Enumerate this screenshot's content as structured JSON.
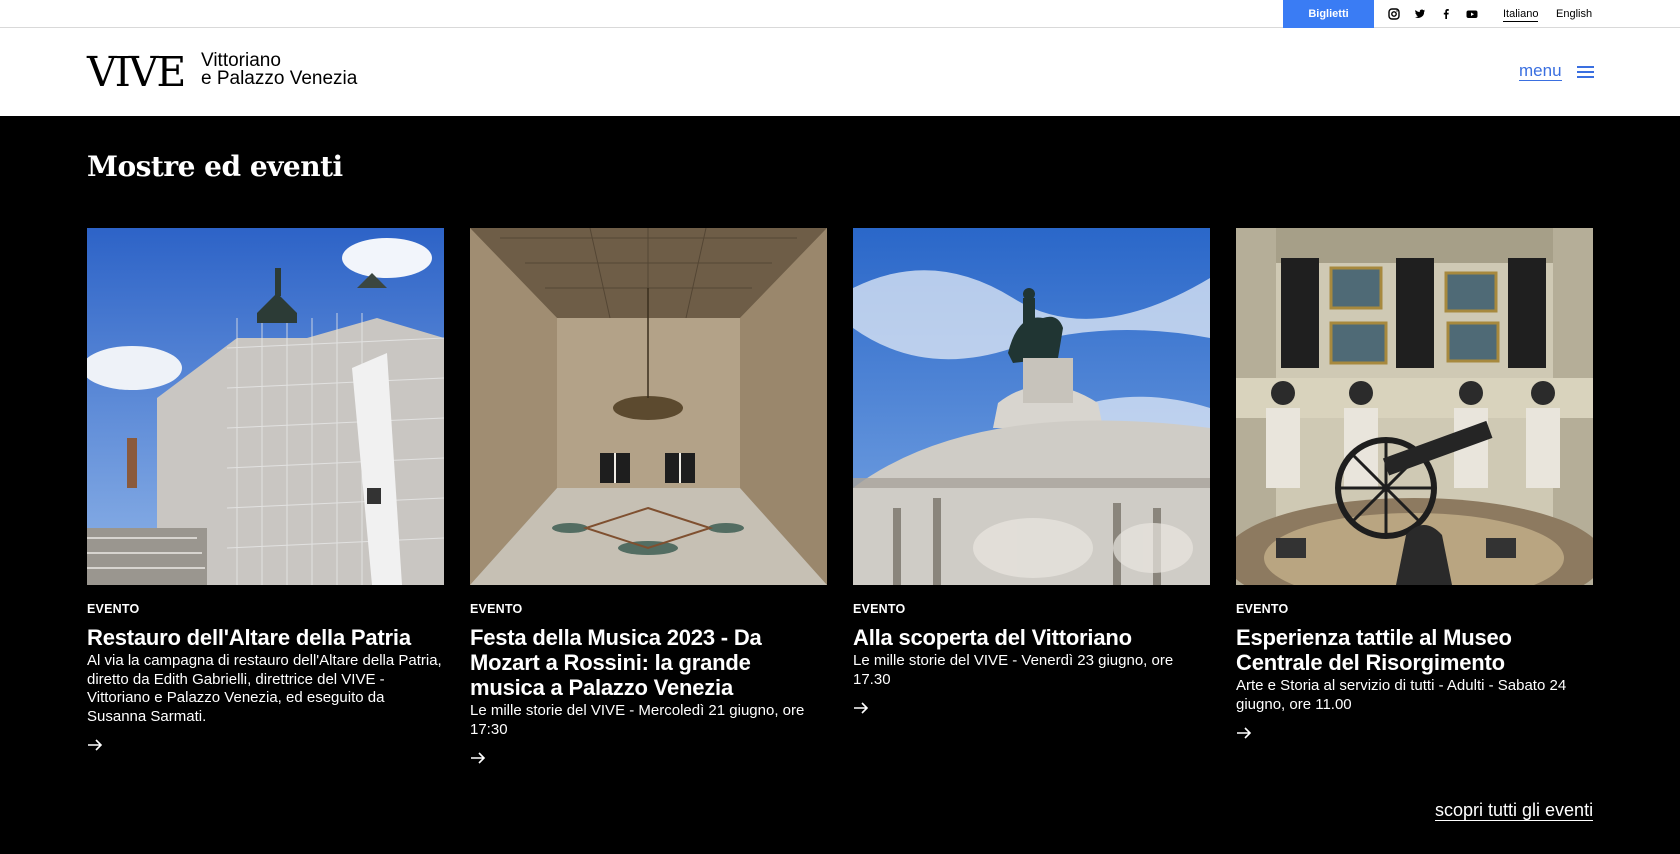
{
  "topbar": {
    "tickets_label": "Biglietti",
    "social": [
      "instagram-icon",
      "twitter-icon",
      "facebook-icon",
      "youtube-icon"
    ],
    "languages": [
      {
        "label": "Italiano",
        "active": true
      },
      {
        "label": "English",
        "active": false
      }
    ]
  },
  "header": {
    "logo_main": "VIVE",
    "logo_line1": "Vittoriano",
    "logo_line2": "e Palazzo Venezia",
    "menu_label": "menu"
  },
  "main": {
    "title": "Mostre ed eventi",
    "cards": [
      {
        "tag": "EVENTO",
        "title": "Restauro dell'Altare della Patria",
        "desc": "Al via la campagna di restauro dell'Altare della Patria, diretto da Edith Gabrielli, direttrice del VIVE - Vittoriano e Palazzo Venezia, ed eseguito da Susanna Sarmati."
      },
      {
        "tag": "EVENTO",
        "title": "Festa della Musica 2023 - Da Mozart a Rossini: la grande musica a Palazzo Venezia",
        "desc": "Le mille storie del VIVE - Mercoledì 21 giugno, ore 17:30"
      },
      {
        "tag": "EVENTO",
        "title": "Alla scoperta del Vittoriano",
        "desc": "Le mille storie del VIVE - Venerdì 23 giugno, ore 17.30"
      },
      {
        "tag": "EVENTO",
        "title": "Esperienza tattile al Museo Centrale del Risorgimento",
        "desc": "Arte e Storia al servizio di tutti - Adulti - Sabato 24 giugno, ore 11.00"
      }
    ],
    "all_events_label": "scopri tutti gli eventi"
  },
  "colors": {
    "accent": "#3a7cf4",
    "menu": "#3a6fe0",
    "background": "#000000"
  }
}
